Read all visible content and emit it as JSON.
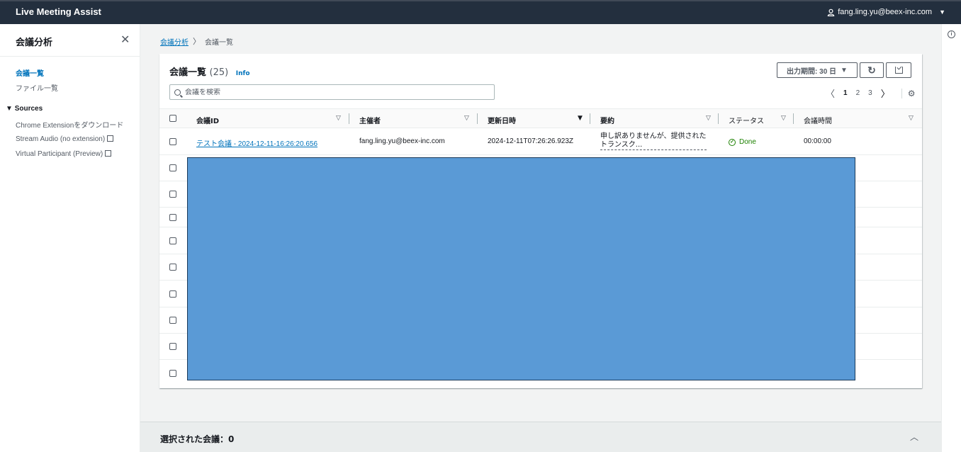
{
  "header": {
    "brand": "Live Meeting Assist",
    "user_email": "fang.ling.yu@beex-inc.com"
  },
  "sidebar": {
    "title": "会議分析",
    "items": [
      {
        "label": "会議一覧",
        "active": true
      },
      {
        "label": "ファイル一覧"
      }
    ],
    "section_title": "Sources",
    "sources": [
      {
        "label": "Chrome Extensionをダウンロード",
        "external": false
      },
      {
        "label": "Stream Audio (no extension)",
        "external": true
      },
      {
        "label": "Virtual Participant (Preview)",
        "external": true
      }
    ]
  },
  "breadcrumb": {
    "parent": "会議分析",
    "current": "会議一覧"
  },
  "table": {
    "title": "会議一覧",
    "count": "(25)",
    "info": "Info",
    "period_label": "出力期間: 30 日",
    "search_placeholder": "会議を検索",
    "pages": [
      "1",
      "2",
      "3"
    ],
    "current_page": "1",
    "columns": [
      "会議ID",
      "主催者",
      "更新日時",
      "要約",
      "ステータス",
      "会議時間"
    ],
    "rows": [
      {
        "id": "テスト会議 - 2024-12-11-16:26:20.656",
        "host": "fang.ling.yu@beex-inc.com",
        "updated": "2024-12-11T07:26:26.923Z",
        "summary_line1": "申し訳ありませんが、提供された",
        "summary_line2": "トランスク...",
        "status": "Done",
        "duration": "00:00:00"
      }
    ]
  },
  "bottom_panel": {
    "label": "選択された会議：0"
  },
  "colors": {
    "header_bg": "#232f3e",
    "link": "#0073bb",
    "status_done": "#1d8102",
    "redaction": "#5a9ad6"
  }
}
